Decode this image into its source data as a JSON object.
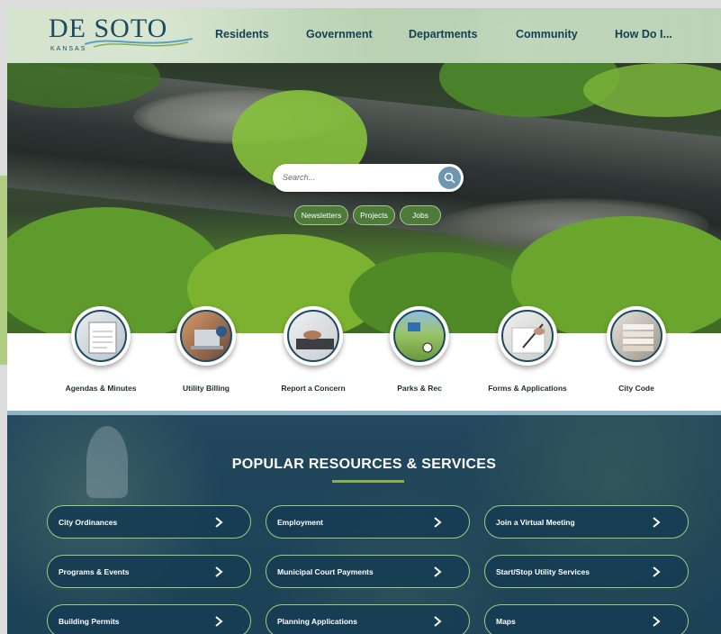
{
  "header": {
    "logo_text": "DE SOTO",
    "logo_sub": "KANSAS",
    "nav": [
      "Residents",
      "Government",
      "Departments",
      "Community",
      "How Do I..."
    ]
  },
  "hero": {
    "search_placeholder": "Search...",
    "pills": [
      "Newsletters",
      "Projects",
      "Jobs"
    ]
  },
  "quick_links": [
    {
      "label": "Agendas & Minutes",
      "icon": "calendar-icon"
    },
    {
      "label": "Utility Billing",
      "icon": "laptop-icon"
    },
    {
      "label": "Report a Concern",
      "icon": "keyboard-icon"
    },
    {
      "label": "Parks & Rec",
      "icon": "park-icon"
    },
    {
      "label": "Forms & Applications",
      "icon": "pen-icon"
    },
    {
      "label": "City Code",
      "icon": "files-icon"
    }
  ],
  "resources": {
    "title": "POPULAR RESOURCES & SERVICES",
    "buttons": [
      "City Ordinances",
      "Employment",
      "Join a Virtual Meeting",
      "Programs & Events",
      "Municipal Court Payments",
      "Start/Stop Utility Services",
      "Building Permits",
      "Planning Applications",
      "Maps"
    ]
  },
  "colors": {
    "brand_navy": "#1c4a5e",
    "accent_green": "#8bb04b",
    "pill_green": "#4e7a3a"
  }
}
